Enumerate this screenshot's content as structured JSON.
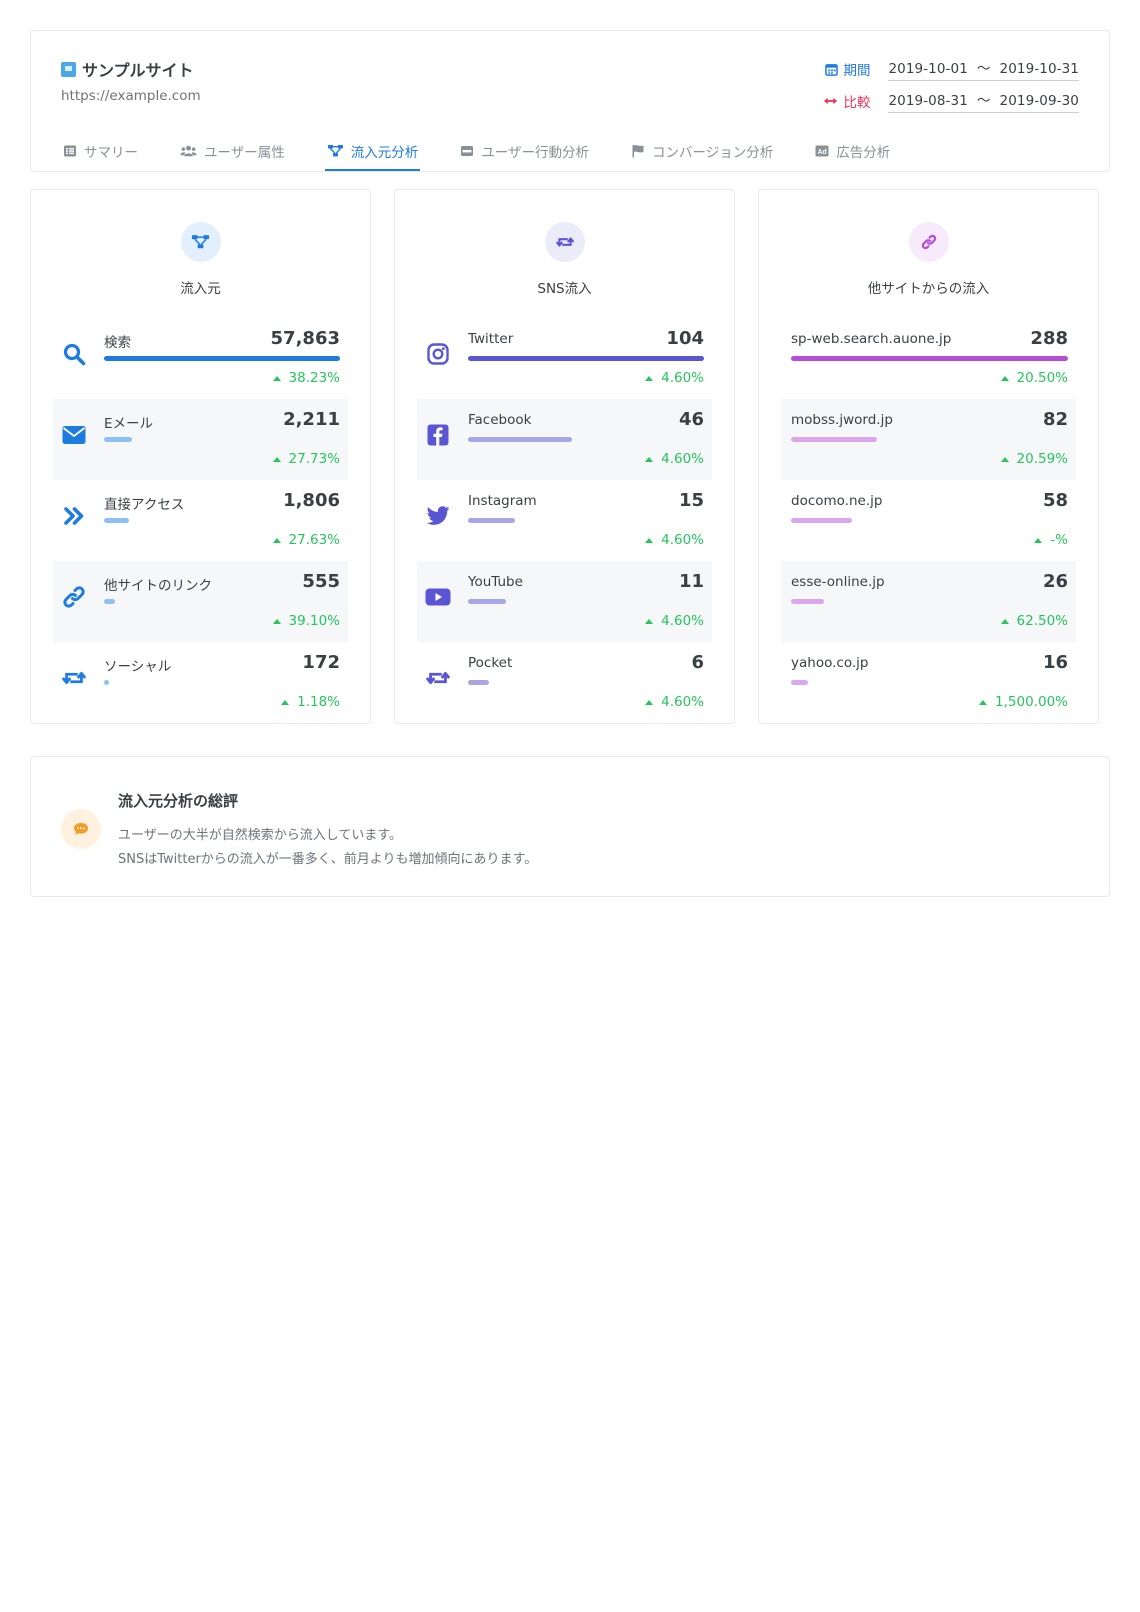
{
  "site": {
    "name": "サンプルサイト",
    "url": "https://example.com"
  },
  "period": {
    "main_label": "期間",
    "main_from": "2019-10-01",
    "main_to": "2019-10-31",
    "compare_label": "比較",
    "compare_from": "2019-08-31",
    "compare_to": "2019-09-30",
    "separator": "〜"
  },
  "tabs": [
    {
      "label": "サマリー",
      "icon": "list-icon"
    },
    {
      "label": "ユーザー属性",
      "icon": "users-icon"
    },
    {
      "label": "流入元分析",
      "icon": "sitemap-icon",
      "active": true
    },
    {
      "label": "ユーザー行動分析",
      "icon": "window-icon"
    },
    {
      "label": "コンバージョン分析",
      "icon": "flag-icon"
    },
    {
      "label": "広告分析",
      "icon": "ad-icon"
    }
  ],
  "colors": {
    "accent": "#1e7be0",
    "compare": "#e8385b",
    "positive": "#27c45e"
  },
  "columns": {
    "sources": {
      "title": "流入元",
      "icon": "sitemap-icon",
      "rows": [
        {
          "label": "検索",
          "value": "57,863",
          "delta": "38.23%",
          "share": 1.0,
          "color": "#1e7be0",
          "icon": "search-icon"
        },
        {
          "label": "Eメール",
          "value": "2,211",
          "delta": "27.73%",
          "share": 0.12,
          "color": "#8fc0f3",
          "icon": "envelope-icon"
        },
        {
          "label": "直接アクセス",
          "value": "1,806",
          "delta": "27.63%",
          "share": 0.106,
          "color": "#8fc0f3",
          "icon": "double-chevron-icon"
        },
        {
          "label": "他サイトのリンク",
          "value": "555",
          "delta": "39.10%",
          "share": 0.045,
          "color": "#8fc0f3",
          "icon": "link-icon"
        },
        {
          "label": "ソーシャル",
          "value": "172",
          "delta": "1.18%",
          "share": 0.022,
          "color": "#8fc0f3",
          "icon": "retweet-icon"
        }
      ]
    },
    "sns": {
      "title": "SNS流入",
      "icon": "retweet-icon",
      "rows": [
        {
          "label": "Twitter",
          "value": "104",
          "delta": "4.60%",
          "share": 1.0,
          "color": "#5a55d2",
          "icon": "instagram-icon"
        },
        {
          "label": "Facebook",
          "value": "46",
          "delta": "4.60%",
          "share": 0.44,
          "color": "#a9a6e6",
          "icon": "facebook-icon"
        },
        {
          "label": "Instagram",
          "value": "15",
          "delta": "4.60%",
          "share": 0.2,
          "color": "#a9a6e6",
          "icon": "twitter-icon"
        },
        {
          "label": "YouTube",
          "value": "11",
          "delta": "4.60%",
          "share": 0.16,
          "color": "#a9a6e6",
          "icon": "youtube-icon"
        },
        {
          "label": "Pocket",
          "value": "6",
          "delta": "4.60%",
          "share": 0.09,
          "color": "#a9a6e6",
          "icon": "retweet-icon"
        }
      ]
    },
    "sites": {
      "title": "他サイトからの流入",
      "icon": "link-icon",
      "rows": [
        {
          "label": "sp-web.search.auone.jp",
          "value": "288",
          "delta": "20.50%",
          "share": 1.0,
          "color": "#b44ed8",
          "icon": ""
        },
        {
          "label": "mobss.jword.jp",
          "value": "82",
          "delta": "20.59%",
          "share": 0.31,
          "color": "#dba7ec",
          "icon": ""
        },
        {
          "label": "docomo.ne.jp",
          "value": "58",
          "delta": "-%",
          "share": 0.22,
          "color": "#dba7ec",
          "icon": ""
        },
        {
          "label": "esse-online.jp",
          "value": "26",
          "delta": "62.50%",
          "share": 0.12,
          "color": "#dba7ec",
          "icon": ""
        },
        {
          "label": "yahoo.co.jp",
          "value": "16",
          "delta": "1,500.00%",
          "share": 0.06,
          "color": "#dba7ec",
          "icon": ""
        }
      ]
    }
  },
  "summary": {
    "title": "流入元分析の総評",
    "line1": "ユーザーの大半が自然検索から流入しています。",
    "line2": "SNSはTwitterからの流入が一番多く、前月よりも増加傾向にあります。",
    "icon": "comment-icon"
  }
}
